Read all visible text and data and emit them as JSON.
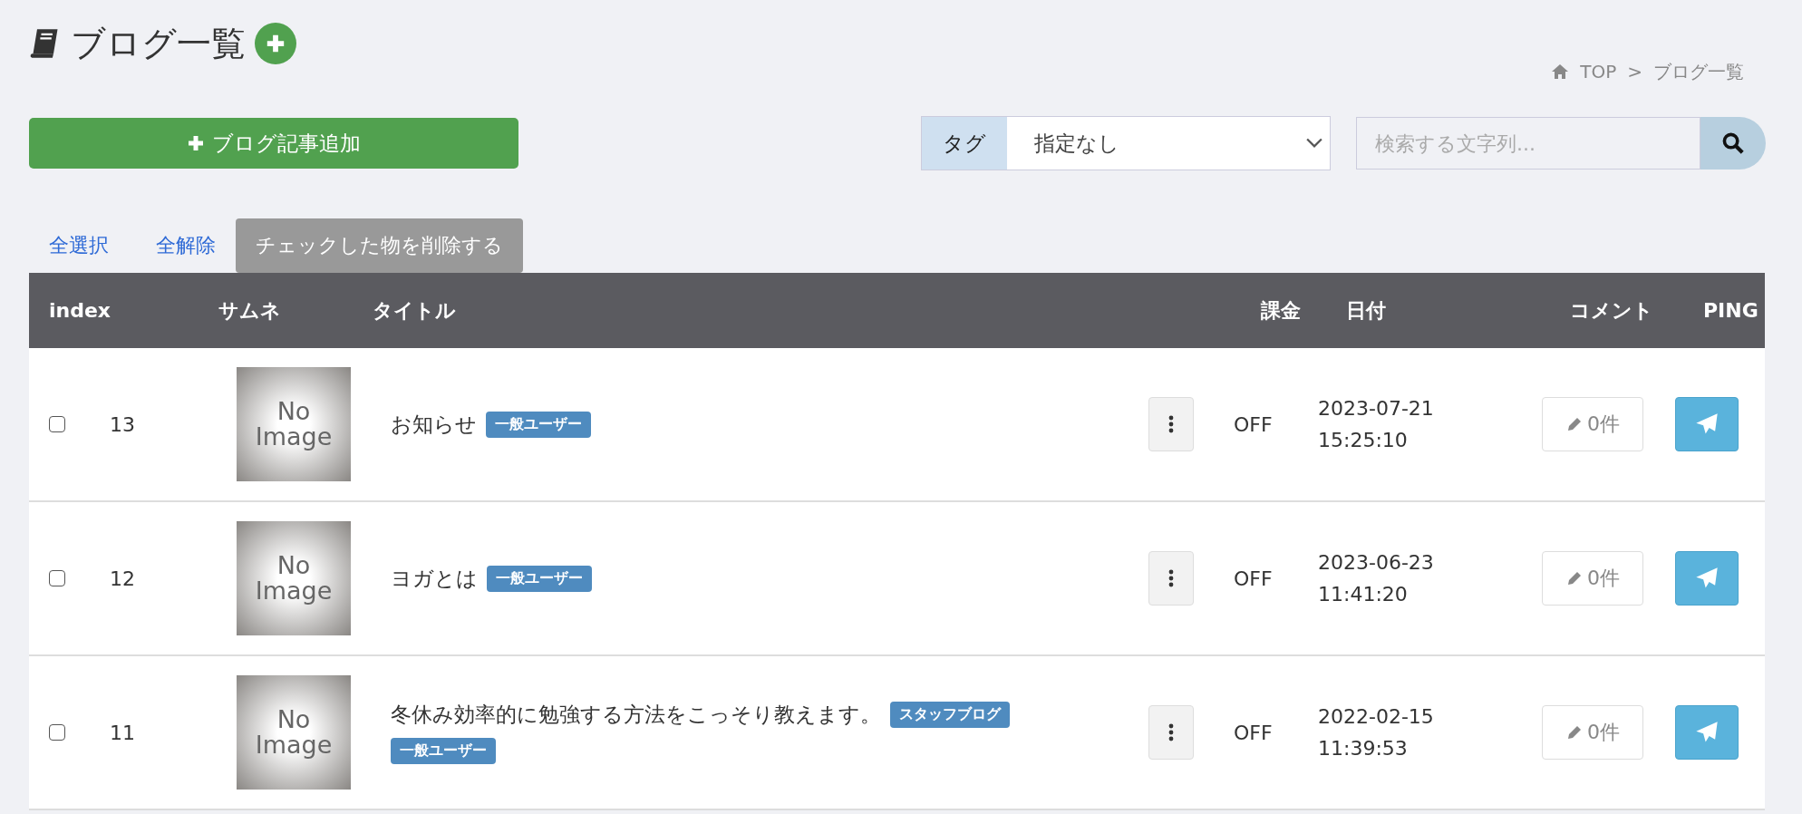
{
  "page": {
    "title": "ブログ一覧"
  },
  "breadcrumb": {
    "home": "TOP",
    "separator": ">",
    "current": "ブログ一覧"
  },
  "add_button": {
    "label": "ブログ記事追加"
  },
  "tag_filter": {
    "label": "タグ",
    "value": "指定なし"
  },
  "search": {
    "placeholder": "検索する文字列..."
  },
  "bulk_actions": {
    "select_all": "全選択",
    "deselect_all": "全解除",
    "delete": "チェックした物を削除する"
  },
  "table": {
    "columns": [
      "index",
      "サムネ",
      "タイトル",
      "課金",
      "日付",
      "コメント",
      "PING"
    ],
    "rows": [
      {
        "checked": false,
        "index": "13",
        "thumbnail": "No Image",
        "title": "お知らせ",
        "tags": [
          "一般ユーザー"
        ],
        "billing": "OFF",
        "date": "2023-07-21",
        "time": "15:25:10",
        "comments": "0件"
      },
      {
        "checked": false,
        "index": "12",
        "thumbnail": "No Image",
        "title": "ヨガとは",
        "tags": [
          "一般ユーザー"
        ],
        "billing": "OFF",
        "date": "2023-06-23",
        "time": "11:41:20",
        "comments": "0件"
      },
      {
        "checked": false,
        "index": "11",
        "thumbnail": "No Image",
        "title": "冬休み効率的に勉強する方法をこっそり教えます。",
        "tags": [
          "スタッフブログ",
          "一般ユーザー"
        ],
        "billing": "OFF",
        "date": "2022-02-15",
        "time": "11:39:53",
        "comments": "0件"
      }
    ]
  }
}
